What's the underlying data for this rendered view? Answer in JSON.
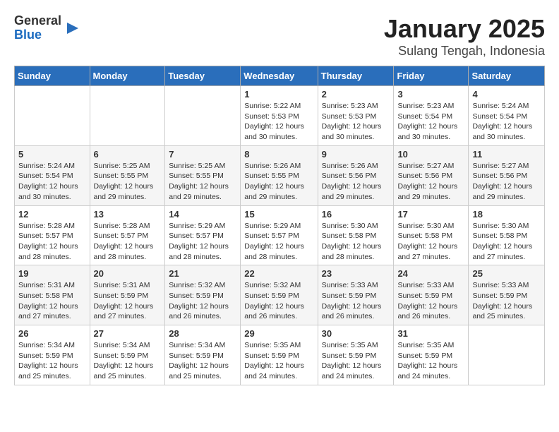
{
  "logo": {
    "general": "General",
    "blue": "Blue"
  },
  "title": "January 2025",
  "subtitle": "Sulang Tengah, Indonesia",
  "weekdays": [
    "Sunday",
    "Monday",
    "Tuesday",
    "Wednesday",
    "Thursday",
    "Friday",
    "Saturday"
  ],
  "weeks": [
    [
      {
        "day": "",
        "info": ""
      },
      {
        "day": "",
        "info": ""
      },
      {
        "day": "",
        "info": ""
      },
      {
        "day": "1",
        "info": "Sunrise: 5:22 AM\nSunset: 5:53 PM\nDaylight: 12 hours and 30 minutes."
      },
      {
        "day": "2",
        "info": "Sunrise: 5:23 AM\nSunset: 5:53 PM\nDaylight: 12 hours and 30 minutes."
      },
      {
        "day": "3",
        "info": "Sunrise: 5:23 AM\nSunset: 5:54 PM\nDaylight: 12 hours and 30 minutes."
      },
      {
        "day": "4",
        "info": "Sunrise: 5:24 AM\nSunset: 5:54 PM\nDaylight: 12 hours and 30 minutes."
      }
    ],
    [
      {
        "day": "5",
        "info": "Sunrise: 5:24 AM\nSunset: 5:54 PM\nDaylight: 12 hours and 30 minutes."
      },
      {
        "day": "6",
        "info": "Sunrise: 5:25 AM\nSunset: 5:55 PM\nDaylight: 12 hours and 29 minutes."
      },
      {
        "day": "7",
        "info": "Sunrise: 5:25 AM\nSunset: 5:55 PM\nDaylight: 12 hours and 29 minutes."
      },
      {
        "day": "8",
        "info": "Sunrise: 5:26 AM\nSunset: 5:55 PM\nDaylight: 12 hours and 29 minutes."
      },
      {
        "day": "9",
        "info": "Sunrise: 5:26 AM\nSunset: 5:56 PM\nDaylight: 12 hours and 29 minutes."
      },
      {
        "day": "10",
        "info": "Sunrise: 5:27 AM\nSunset: 5:56 PM\nDaylight: 12 hours and 29 minutes."
      },
      {
        "day": "11",
        "info": "Sunrise: 5:27 AM\nSunset: 5:56 PM\nDaylight: 12 hours and 29 minutes."
      }
    ],
    [
      {
        "day": "12",
        "info": "Sunrise: 5:28 AM\nSunset: 5:57 PM\nDaylight: 12 hours and 28 minutes."
      },
      {
        "day": "13",
        "info": "Sunrise: 5:28 AM\nSunset: 5:57 PM\nDaylight: 12 hours and 28 minutes."
      },
      {
        "day": "14",
        "info": "Sunrise: 5:29 AM\nSunset: 5:57 PM\nDaylight: 12 hours and 28 minutes."
      },
      {
        "day": "15",
        "info": "Sunrise: 5:29 AM\nSunset: 5:57 PM\nDaylight: 12 hours and 28 minutes."
      },
      {
        "day": "16",
        "info": "Sunrise: 5:30 AM\nSunset: 5:58 PM\nDaylight: 12 hours and 28 minutes."
      },
      {
        "day": "17",
        "info": "Sunrise: 5:30 AM\nSunset: 5:58 PM\nDaylight: 12 hours and 27 minutes."
      },
      {
        "day": "18",
        "info": "Sunrise: 5:30 AM\nSunset: 5:58 PM\nDaylight: 12 hours and 27 minutes."
      }
    ],
    [
      {
        "day": "19",
        "info": "Sunrise: 5:31 AM\nSunset: 5:58 PM\nDaylight: 12 hours and 27 minutes."
      },
      {
        "day": "20",
        "info": "Sunrise: 5:31 AM\nSunset: 5:59 PM\nDaylight: 12 hours and 27 minutes."
      },
      {
        "day": "21",
        "info": "Sunrise: 5:32 AM\nSunset: 5:59 PM\nDaylight: 12 hours and 26 minutes."
      },
      {
        "day": "22",
        "info": "Sunrise: 5:32 AM\nSunset: 5:59 PM\nDaylight: 12 hours and 26 minutes."
      },
      {
        "day": "23",
        "info": "Sunrise: 5:33 AM\nSunset: 5:59 PM\nDaylight: 12 hours and 26 minutes."
      },
      {
        "day": "24",
        "info": "Sunrise: 5:33 AM\nSunset: 5:59 PM\nDaylight: 12 hours and 26 minutes."
      },
      {
        "day": "25",
        "info": "Sunrise: 5:33 AM\nSunset: 5:59 PM\nDaylight: 12 hours and 25 minutes."
      }
    ],
    [
      {
        "day": "26",
        "info": "Sunrise: 5:34 AM\nSunset: 5:59 PM\nDaylight: 12 hours and 25 minutes."
      },
      {
        "day": "27",
        "info": "Sunrise: 5:34 AM\nSunset: 5:59 PM\nDaylight: 12 hours and 25 minutes."
      },
      {
        "day": "28",
        "info": "Sunrise: 5:34 AM\nSunset: 5:59 PM\nDaylight: 12 hours and 25 minutes."
      },
      {
        "day": "29",
        "info": "Sunrise: 5:35 AM\nSunset: 5:59 PM\nDaylight: 12 hours and 24 minutes."
      },
      {
        "day": "30",
        "info": "Sunrise: 5:35 AM\nSunset: 5:59 PM\nDaylight: 12 hours and 24 minutes."
      },
      {
        "day": "31",
        "info": "Sunrise: 5:35 AM\nSunset: 5:59 PM\nDaylight: 12 hours and 24 minutes."
      },
      {
        "day": "",
        "info": ""
      }
    ]
  ]
}
